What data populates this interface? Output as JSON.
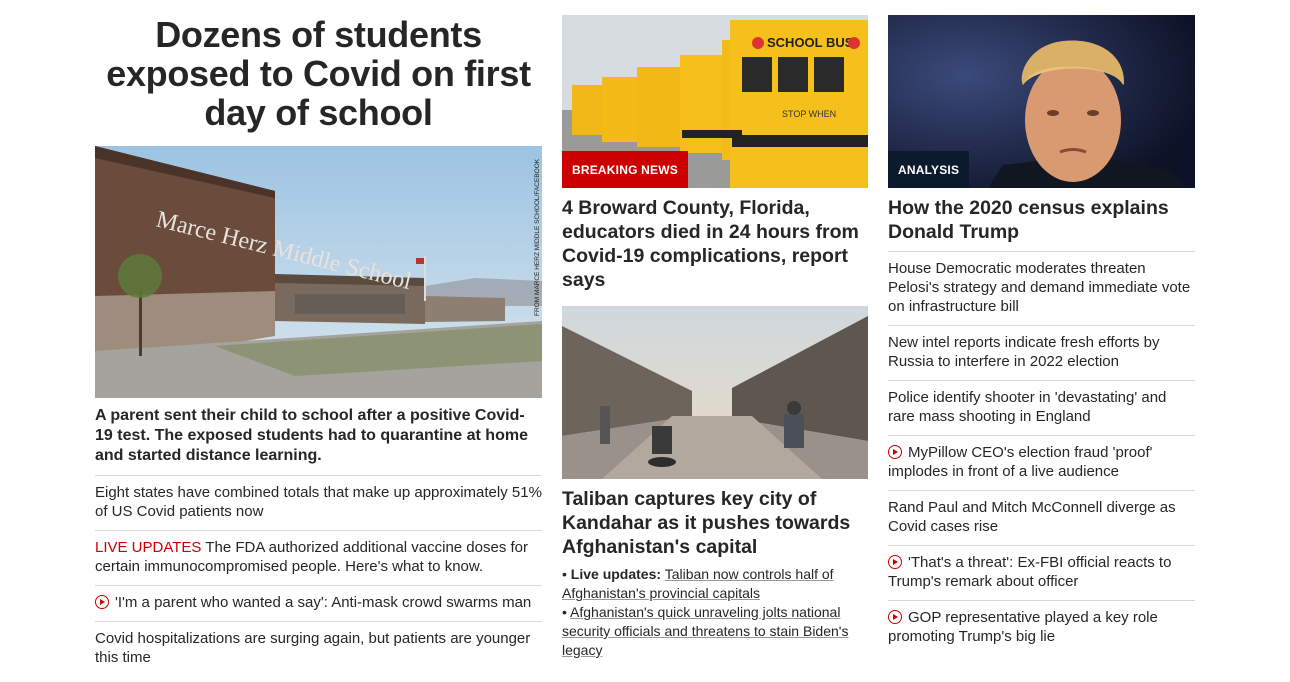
{
  "col1": {
    "headline": "Dozens of students exposed to Covid on first day of school",
    "image_credit": "FROM MARCE HERZ MIDDLE SCHOOL/FACEBOOK",
    "image_sign": "Marce Herz Middle School",
    "summary": "A parent sent their child to school after a positive Covid-19 test. The exposed students had to quarantine at home and started distance learning.",
    "items": [
      {
        "text": "Eight states have combined totals that make up approximately 51% of US Covid patients now"
      },
      {
        "prefix": "LIVE UPDATES",
        "text": "The FDA authorized additional vaccine doses for certain immunocompromised people. Here's what to know."
      },
      {
        "video": true,
        "text": "'I'm a parent who wanted a say': Anti-mask crowd swarms man"
      },
      {
        "text": "Covid hospitalizations are surging again, but patients are younger this time"
      }
    ]
  },
  "col2": {
    "card1": {
      "badge": "BREAKING NEWS",
      "bus_text": "SCHOOL BUS",
      "stop_text": "STOP WHEN",
      "headline": "4 Broward County, Florida, educators died in 24 hours from Covid-19 complications, report says"
    },
    "card2": {
      "headline": "Taliban captures key city of Kandahar as it pushes towards Afghanistan's capital",
      "bullets": [
        {
          "bold": "Live updates:",
          "text": "Taliban now controls half of Afghanistan's provincial capitals"
        },
        {
          "bold": "",
          "text": "Afghanistan's quick unraveling jolts national security officials and threatens to stain Biden's legacy"
        }
      ]
    }
  },
  "col3": {
    "badge": "ANALYSIS",
    "headline": "How the 2020 census explains Donald Trump",
    "items": [
      {
        "text": "House Democratic moderates threaten Pelosi's strategy and demand immediate vote on infrastructure bill"
      },
      {
        "text": "New intel reports indicate fresh efforts by Russia to interfere in 2022 election"
      },
      {
        "text": "Police identify shooter in 'devastating' and rare mass shooting in England"
      },
      {
        "video": true,
        "text": "MyPillow CEO's election fraud 'proof' implodes in front of a live audience"
      },
      {
        "text": "Rand Paul and Mitch McConnell diverge as Covid cases rise"
      },
      {
        "video": true,
        "text": "'That's a threat': Ex-FBI official reacts to Trump's remark about officer"
      },
      {
        "video": true,
        "text": "GOP representative played a key role promoting Trump's big lie"
      }
    ]
  },
  "colors": {
    "accent_red": "#cc0000",
    "analysis_navy": "#0c1a2e",
    "text": "#262626"
  }
}
